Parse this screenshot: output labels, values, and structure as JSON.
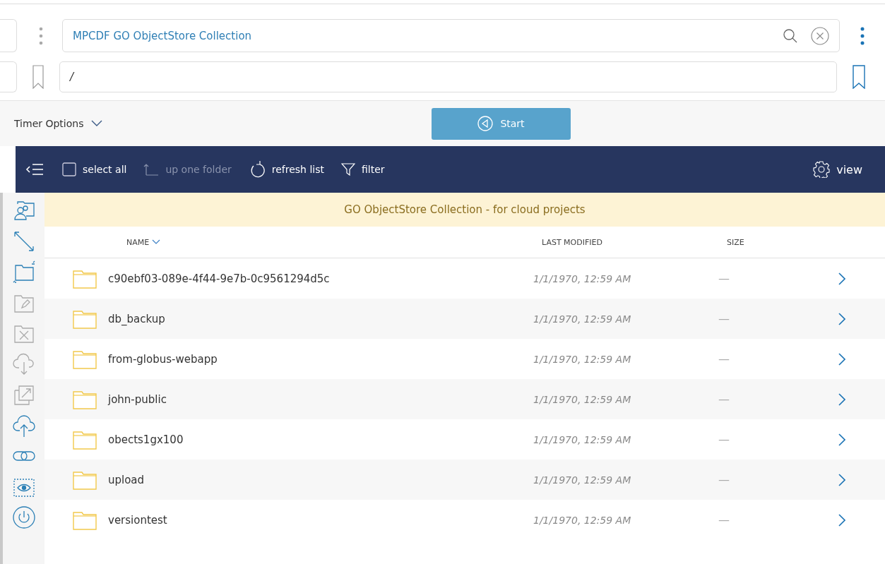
{
  "collection": {
    "value": "MPCDF GO ObjectStore Collection"
  },
  "path": {
    "value": "/"
  },
  "timer_options": {
    "label": "Timer Options",
    "expanded": false
  },
  "start_button": {
    "label": "Start"
  },
  "toolbar": [
    {
      "kind": "select",
      "label": "select all",
      "checked": false,
      "disabled": false
    },
    {
      "kind": "up",
      "label": "up one folder",
      "disabled": true
    },
    {
      "kind": "refresh",
      "label": "refresh list",
      "disabled": false
    },
    {
      "kind": "filter",
      "label": "filter",
      "disabled": false
    }
  ],
  "view_button": {
    "label": "view"
  },
  "side_tools": [
    {
      "kind": "share",
      "disabled": false
    },
    {
      "kind": "transfer",
      "disabled": false
    },
    {
      "kind": "new-folder",
      "disabled": false
    },
    {
      "kind": "rename",
      "disabled": true
    },
    {
      "kind": "delete",
      "disabled": true
    },
    {
      "kind": "download",
      "disabled": true
    },
    {
      "kind": "open",
      "disabled": true
    },
    {
      "kind": "upload",
      "disabled": false
    },
    {
      "kind": "link",
      "disabled": false
    },
    {
      "kind": "show-hidden",
      "disabled": false
    },
    {
      "kind": "power",
      "disabled": false
    }
  ],
  "banner": "GO ObjectStore Collection - for cloud projects",
  "table": {
    "columns": [
      "NAME",
      "LAST MODIFIED",
      "SIZE"
    ],
    "rows": [
      {
        "name": "c90ebf03-089e-4f44-9e7b-0c9561294d5c",
        "modified": "1/1/1970, 12:59 AM",
        "size": "—"
      },
      {
        "name": "db_backup",
        "modified": "1/1/1970, 12:59 AM",
        "size": "—"
      },
      {
        "name": "from-globus-webapp",
        "modified": "1/1/1970, 12:59 AM",
        "size": "—"
      },
      {
        "name": "john-public",
        "modified": "1/1/1970, 12:59 AM",
        "size": "—"
      },
      {
        "name": "obects1gx100",
        "modified": "1/1/1970, 12:59 AM",
        "size": "—"
      },
      {
        "name": "upload",
        "modified": "1/1/1970, 12:59 AM",
        "size": "—"
      },
      {
        "name": "versiontest",
        "modified": "1/1/1970, 12:59 AM",
        "size": "—"
      }
    ]
  }
}
